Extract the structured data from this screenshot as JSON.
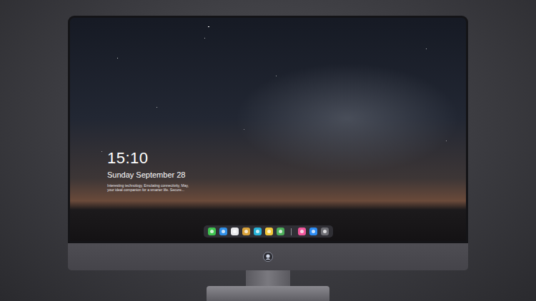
{
  "lock_screen": {
    "time": "15:10",
    "date": "Sunday September 28",
    "caption": [
      "Interesting technology, Emulating connectivity, May,",
      "your ideal companion for a smarter life. Secure..."
    ]
  },
  "dock": {
    "items": [
      {
        "kind": "app",
        "color": "#3fc34f"
      },
      {
        "kind": "app",
        "color": "#2f8fe8"
      },
      {
        "kind": "app",
        "color": "#e9e9ec"
      },
      {
        "kind": "app",
        "color": "#d9a23a"
      },
      {
        "kind": "app",
        "color": "#27b3d9"
      },
      {
        "kind": "app",
        "color": "#f3c83a"
      },
      {
        "kind": "app",
        "color": "#4cae5a"
      },
      {
        "kind": "separator",
        "color": "#8a8a90"
      },
      {
        "kind": "app",
        "color": "#f0569b"
      },
      {
        "kind": "app",
        "color": "#2c8cf4"
      },
      {
        "kind": "app",
        "color": "#6e6e74"
      }
    ]
  }
}
